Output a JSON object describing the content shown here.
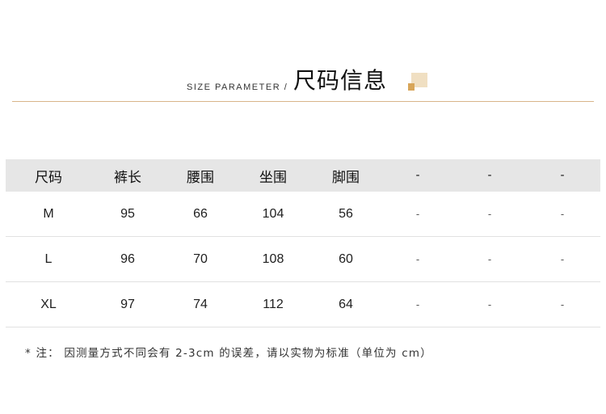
{
  "header": {
    "subtitle": "SIZE PARAMETER /",
    "title": "尺码信息"
  },
  "table": {
    "columns": [
      "尺码",
      "裤长",
      "腰围",
      "坐围",
      "脚围",
      "-",
      "-",
      "-"
    ],
    "rows": [
      [
        "M",
        "95",
        "66",
        "104",
        "56",
        "-",
        "-",
        "-"
      ],
      [
        "L",
        "96",
        "70",
        "108",
        "60",
        "-",
        "-",
        "-"
      ],
      [
        "XL",
        "97",
        "74",
        "112",
        "64",
        "-",
        "-",
        "-"
      ]
    ]
  },
  "note": "* 注： 因测量方式不同会有 2-3cm 的误差，请以实物为标准（单位为 cm）",
  "colors": {
    "accent_rule": "#d9b58a",
    "deco_light": "#f0dfc2",
    "deco_dark": "#d8a65a",
    "header_row_bg": "#e6e6e6"
  }
}
